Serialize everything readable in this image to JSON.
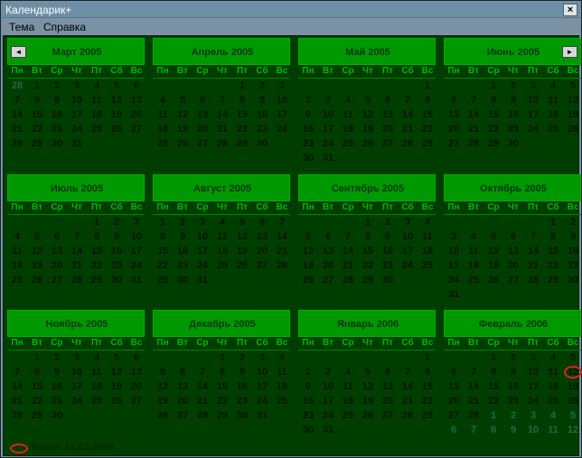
{
  "window": {
    "title": "Календарик+",
    "close_glyph": "×"
  },
  "menu": [
    "Тема",
    "Справка"
  ],
  "nav": {
    "prev_glyph": "◄",
    "next_glyph": "►"
  },
  "weekdays": [
    "Пн",
    "Вт",
    "Ср",
    "Чт",
    "Пт",
    "Сб",
    "Вс"
  ],
  "months": [
    {
      "title": "Март 2005",
      "weeks": [
        [
          "28",
          "1",
          "2",
          "3",
          "4",
          "5",
          "6"
        ],
        [
          "7",
          "8",
          "9",
          "10",
          "11",
          "12",
          "13"
        ],
        [
          "14",
          "15",
          "16",
          "17",
          "18",
          "19",
          "20"
        ],
        [
          "21",
          "22",
          "23",
          "24",
          "25",
          "26",
          "27"
        ],
        [
          "28",
          "29",
          "30",
          "31",
          "",
          "",
          ""
        ]
      ],
      "trail_first": 1,
      "trail_last": 0
    },
    {
      "title": "Апрель 2005",
      "weeks": [
        [
          "",
          "",
          "",
          "",
          "1",
          "2",
          "3"
        ],
        [
          "4",
          "5",
          "6",
          "7",
          "8",
          "9",
          "10"
        ],
        [
          "11",
          "12",
          "13",
          "14",
          "15",
          "16",
          "17"
        ],
        [
          "18",
          "19",
          "20",
          "21",
          "22",
          "23",
          "24"
        ],
        [
          "25",
          "26",
          "27",
          "28",
          "29",
          "30",
          ""
        ]
      ],
      "trail_first": 0,
      "trail_last": 0
    },
    {
      "title": "Май 2005",
      "weeks": [
        [
          "",
          "",
          "",
          "",
          "",
          "",
          "1"
        ],
        [
          "2",
          "3",
          "4",
          "5",
          "6",
          "7",
          "8"
        ],
        [
          "9",
          "10",
          "11",
          "12",
          "13",
          "14",
          "15"
        ],
        [
          "16",
          "17",
          "18",
          "19",
          "20",
          "21",
          "22"
        ],
        [
          "23",
          "24",
          "25",
          "26",
          "27",
          "28",
          "29"
        ],
        [
          "30",
          "31",
          "",
          "",
          "",
          "",
          ""
        ]
      ],
      "trail_first": 0,
      "trail_last": 0
    },
    {
      "title": "Июнь 2005",
      "weeks": [
        [
          "",
          "",
          "1",
          "2",
          "3",
          "4",
          "5"
        ],
        [
          "6",
          "7",
          "8",
          "9",
          "10",
          "11",
          "12"
        ],
        [
          "13",
          "14",
          "15",
          "16",
          "17",
          "18",
          "19"
        ],
        [
          "20",
          "21",
          "22",
          "23",
          "24",
          "25",
          "26"
        ],
        [
          "27",
          "28",
          "29",
          "30",
          "",
          "",
          ""
        ]
      ],
      "trail_first": 0,
      "trail_last": 0
    },
    {
      "title": "Июль 2005",
      "weeks": [
        [
          "",
          "",
          "",
          "",
          "1",
          "2",
          "3"
        ],
        [
          "4",
          "5",
          "6",
          "7",
          "8",
          "9",
          "10"
        ],
        [
          "11",
          "12",
          "13",
          "14",
          "15",
          "16",
          "17"
        ],
        [
          "18",
          "19",
          "20",
          "21",
          "22",
          "23",
          "24"
        ],
        [
          "25",
          "26",
          "27",
          "28",
          "29",
          "30",
          "31"
        ]
      ],
      "trail_first": 0,
      "trail_last": 0
    },
    {
      "title": "Август 2005",
      "weeks": [
        [
          "1",
          "2",
          "3",
          "4",
          "5",
          "6",
          "7"
        ],
        [
          "8",
          "9",
          "10",
          "11",
          "12",
          "13",
          "14"
        ],
        [
          "15",
          "16",
          "17",
          "18",
          "19",
          "20",
          "21"
        ],
        [
          "22",
          "23",
          "24",
          "25",
          "26",
          "27",
          "28"
        ],
        [
          "29",
          "30",
          "31",
          "",
          "",
          "",
          ""
        ]
      ],
      "trail_first": 0,
      "trail_last": 0
    },
    {
      "title": "Сентябрь 2005",
      "weeks": [
        [
          "",
          "",
          "",
          "1",
          "2",
          "3",
          "4"
        ],
        [
          "5",
          "6",
          "7",
          "8",
          "9",
          "10",
          "11"
        ],
        [
          "12",
          "13",
          "14",
          "15",
          "16",
          "17",
          "18"
        ],
        [
          "19",
          "20",
          "21",
          "22",
          "23",
          "24",
          "25"
        ],
        [
          "26",
          "27",
          "28",
          "29",
          "30",
          "",
          ""
        ]
      ],
      "trail_first": 0,
      "trail_last": 0
    },
    {
      "title": "Октябрь 2005",
      "weeks": [
        [
          "",
          "",
          "",
          "",
          "",
          "1",
          "2"
        ],
        [
          "3",
          "4",
          "5",
          "6",
          "7",
          "8",
          "9"
        ],
        [
          "10",
          "11",
          "12",
          "13",
          "14",
          "15",
          "16"
        ],
        [
          "17",
          "18",
          "19",
          "20",
          "21",
          "22",
          "23"
        ],
        [
          "24",
          "25",
          "26",
          "27",
          "28",
          "29",
          "30"
        ],
        [
          "31",
          "",
          "",
          "",
          "",
          "",
          ""
        ]
      ],
      "trail_first": 0,
      "trail_last": 0
    },
    {
      "title": "Ноябрь 2005",
      "weeks": [
        [
          "",
          "1",
          "2",
          "3",
          "4",
          "5",
          "6"
        ],
        [
          "7",
          "8",
          "9",
          "10",
          "11",
          "12",
          "13"
        ],
        [
          "14",
          "15",
          "16",
          "17",
          "18",
          "19",
          "20"
        ],
        [
          "21",
          "22",
          "23",
          "24",
          "25",
          "26",
          "27"
        ],
        [
          "28",
          "29",
          "30",
          "",
          "",
          "",
          ""
        ]
      ],
      "trail_first": 0,
      "trail_last": 0
    },
    {
      "title": "Декабрь 2005",
      "weeks": [
        [
          "",
          "",
          "",
          "1",
          "2",
          "3",
          "4"
        ],
        [
          "5",
          "6",
          "7",
          "8",
          "9",
          "10",
          "11"
        ],
        [
          "12",
          "13",
          "14",
          "15",
          "16",
          "17",
          "18"
        ],
        [
          "19",
          "20",
          "21",
          "22",
          "23",
          "24",
          "25"
        ],
        [
          "26",
          "27",
          "28",
          "29",
          "30",
          "31",
          ""
        ]
      ],
      "trail_first": 0,
      "trail_last": 0
    },
    {
      "title": "Январь 2006",
      "weeks": [
        [
          "",
          "",
          "",
          "",
          "",
          "",
          "1"
        ],
        [
          "2",
          "3",
          "4",
          "5",
          "6",
          "7",
          "8"
        ],
        [
          "9",
          "10",
          "11",
          "12",
          "13",
          "14",
          "15"
        ],
        [
          "16",
          "17",
          "18",
          "19",
          "20",
          "21",
          "22"
        ],
        [
          "23",
          "24",
          "25",
          "26",
          "27",
          "28",
          "29"
        ],
        [
          "30",
          "31",
          "",
          "",
          "",
          "",
          ""
        ]
      ],
      "trail_first": 0,
      "trail_last": 0
    },
    {
      "title": "Февраль 2006",
      "weeks": [
        [
          "",
          "",
          "1",
          "2",
          "3",
          "4",
          "5"
        ],
        [
          "6",
          "7",
          "8",
          "9",
          "10",
          "11",
          "12"
        ],
        [
          "13",
          "14",
          "15",
          "16",
          "17",
          "18",
          "19"
        ],
        [
          "20",
          "21",
          "22",
          "23",
          "24",
          "25",
          "26"
        ],
        [
          "27",
          "28",
          "1",
          "2",
          "3",
          "4",
          "5"
        ],
        [
          "6",
          "7",
          "8",
          "9",
          "10",
          "11",
          "12"
        ]
      ],
      "trail_first": 0,
      "trail_last": 12,
      "today_day": "12"
    }
  ],
  "status": {
    "today_text": "Today: 12.02.2006"
  },
  "colors": {
    "background": "#003e00",
    "header": "#009800",
    "weekday": "#00b800",
    "day": "#001600",
    "trail": "#1a6c4a",
    "today_mark": "#e02020"
  }
}
